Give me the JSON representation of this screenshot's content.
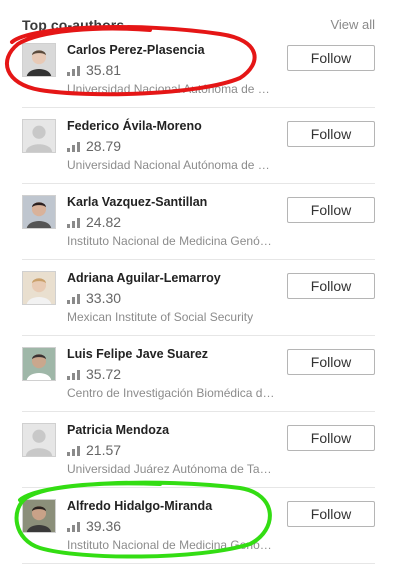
{
  "header": {
    "title": "Top co-authors",
    "view_all": "View all"
  },
  "authors": [
    {
      "name": "Carlos Perez-Plasencia",
      "score": "35.81",
      "institution": "Universidad Nacional Autónoma de México",
      "follow": "Follow",
      "avatar": "photo",
      "skin": "#e7c9b6",
      "hair": "#5a4a3c",
      "bg": "#d9d9d9",
      "shirt": "#333333"
    },
    {
      "name": "Federico Ávila-Moreno",
      "score": "28.79",
      "institution": "Universidad Nacional Autónoma de México",
      "follow": "Follow",
      "avatar": "placeholder"
    },
    {
      "name": "Karla Vazquez-Santillan",
      "score": "24.82",
      "institution": "Instituto Nacional de Medicina Genómica",
      "follow": "Follow",
      "avatar": "photo",
      "skin": "#d9b29a",
      "hair": "#2b2020",
      "bg": "#bfc6cf",
      "shirt": "#555555"
    },
    {
      "name": "Adriana Aguilar-Lemarroy",
      "score": "33.30",
      "institution": "Mexican Institute of Social Security",
      "follow": "Follow",
      "avatar": "photo",
      "skin": "#e8cbb4",
      "hair": "#c9a06a",
      "bg": "#e9dfcf",
      "shirt": "#f2f2f2"
    },
    {
      "name": "Luis Felipe Jave Suarez",
      "score": "35.72",
      "institution": "Centro de Investigación Biomédica de Occidente",
      "follow": "Follow",
      "avatar": "photo",
      "skin": "#caa78d",
      "hair": "#3a3232",
      "bg": "#9fb7a8",
      "shirt": "#ffffff"
    },
    {
      "name": "Patricia Mendoza",
      "score": "21.57",
      "institution": "Universidad Juárez Autónoma de Tabasco",
      "follow": "Follow",
      "avatar": "placeholder"
    },
    {
      "name": "Alfredo Hidalgo-Miranda",
      "score": "39.36",
      "institution": "Instituto Nacional de Medicina Genómica",
      "follow": "Follow",
      "avatar": "photo",
      "skin": "#c9a288",
      "hair": "#2a2320",
      "bg": "#8b8f7a",
      "shirt": "#3a3a3a"
    }
  ],
  "annotations": [
    {
      "color": "#e51616"
    },
    {
      "color": "#33dd13"
    }
  ]
}
